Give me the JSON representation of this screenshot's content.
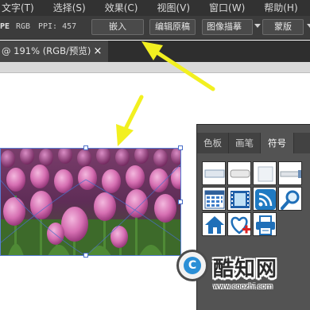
{
  "menubar": {
    "items": [
      "文字(T)",
      "选择(S)",
      "效果(C)",
      "视图(V)",
      "窗口(W)",
      "帮助(H)"
    ]
  },
  "controlbar": {
    "partial_label": "PE",
    "color_mode": "RGB",
    "ppi": "PPI: 457",
    "buttons": {
      "embed": "嵌入",
      "edit_original": "编辑原稿",
      "image_trace": "图像描摹",
      "mask": "蒙版"
    }
  },
  "document_tab": {
    "title": "@ 191% (RGB/预览)",
    "close": "×"
  },
  "symbols_panel": {
    "tabs": [
      "色板",
      "画笔",
      "符号"
    ],
    "active_tab": "符号",
    "symbols": [
      "rectangle-button-symbol",
      "rounded-button-symbol",
      "plain-square-symbol",
      "slider-symbol",
      "calendar-grid-symbol",
      "film-strip-symbol",
      "rss-feed-symbol",
      "magnifier-symbol",
      "home-symbol",
      "heart-add-symbol",
      "printer-symbol"
    ]
  },
  "watermark": {
    "logo_letter": "C",
    "brand": "酷知网",
    "url": "www.coozhi.com"
  },
  "colors": {
    "menubar_bg": "#323232",
    "controlbar_bg": "#3c3c3c",
    "panel_bg": "#535353",
    "arrow": "#f2f020",
    "selection": "#4a6fc9",
    "watermark_blue": "#2b8fd6"
  }
}
